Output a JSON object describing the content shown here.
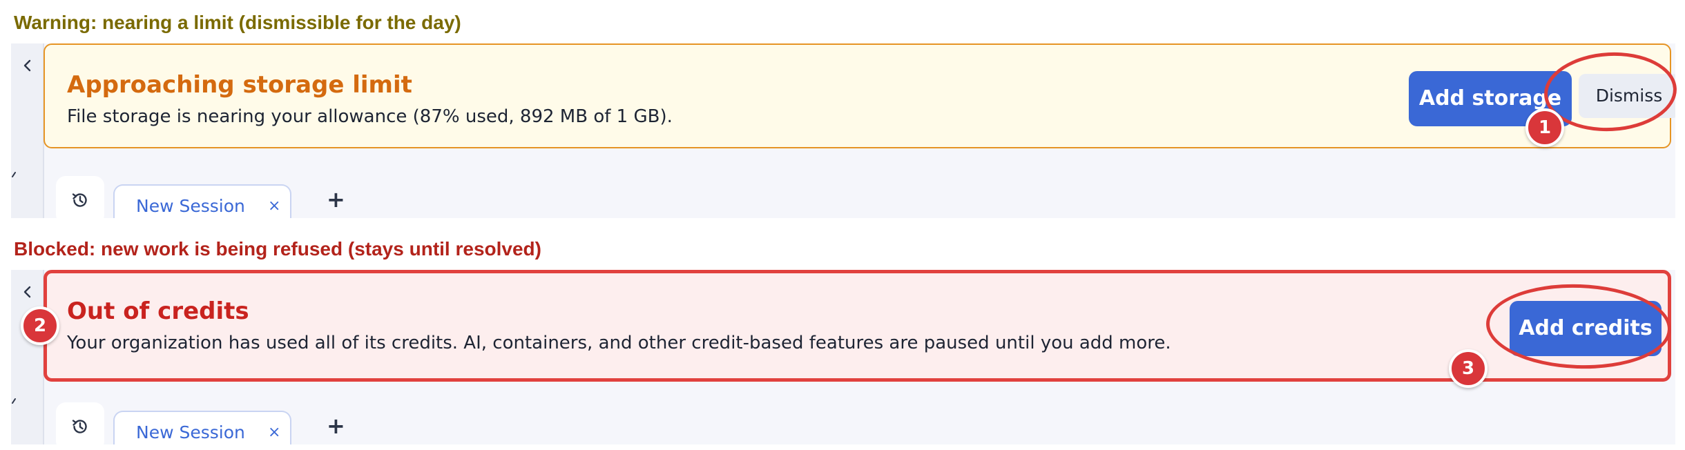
{
  "sections": {
    "warning": {
      "caption": "Warning: nearing a limit (dismissible for the day)",
      "banner": {
        "title": "Approaching storage limit",
        "description": "File storage is nearing your allowance (87% used, 892 MB of 1 GB).",
        "primary_label": "Add storage",
        "secondary_label": "Dismiss"
      },
      "tabs": {
        "session_label": "New Session",
        "close_glyph": "×",
        "add_glyph": "+"
      },
      "marker": "1"
    },
    "blocked": {
      "caption": "Blocked: new work is being refused (stays until resolved)",
      "banner": {
        "title": "Out of credits",
        "description": "Your organization has used all of its credits. AI, containers, and other credit-based features are paused until you add more.",
        "primary_label": "Add credits"
      },
      "tabs": {
        "session_label": "New Session",
        "close_glyph": "×",
        "add_glyph": "+"
      },
      "markers": [
        "2",
        "3"
      ]
    }
  },
  "icons": {
    "rail_toggle": "chevron-left-icon",
    "history": "history-icon"
  },
  "colors": {
    "primary": "#3a68d6",
    "warning_text": "#d46a0f",
    "warning_border": "#e69424",
    "warning_bg": "#fffbe9",
    "error_text": "#c9231f",
    "error_border": "#e1413e",
    "error_bg": "#fdeeee",
    "annotation": "#dd3c39"
  }
}
